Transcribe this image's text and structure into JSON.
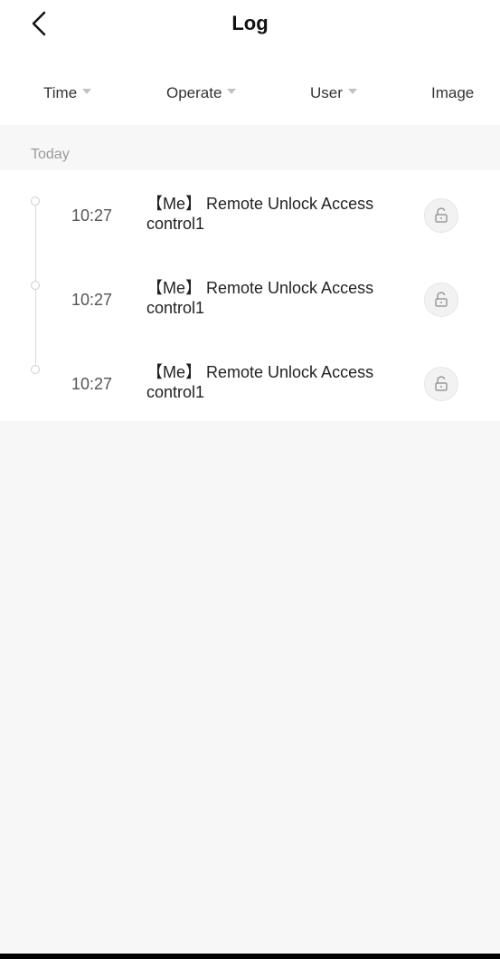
{
  "header": {
    "title": "Log",
    "back_icon": "chevron-left-icon"
  },
  "filters": [
    {
      "label": "Time",
      "has_dropdown": true
    },
    {
      "label": "Operate",
      "has_dropdown": true
    },
    {
      "label": "User",
      "has_dropdown": true
    },
    {
      "label": "Image",
      "has_dropdown": false
    }
  ],
  "section": {
    "label": "Today"
  },
  "entries": [
    {
      "time": "10:27",
      "description": "【Me】 Remote Unlock Access control1",
      "icon": "unlock-icon"
    },
    {
      "time": "10:27",
      "description": "【Me】 Remote Unlock Access control1",
      "icon": "unlock-icon"
    },
    {
      "time": "10:27",
      "description": "【Me】 Remote Unlock Access control1",
      "icon": "unlock-icon"
    }
  ],
  "colors": {
    "background": "#f7f7f7",
    "surface": "#ffffff",
    "muted_text": "#9a9a9a",
    "caret": "#c2c2c2"
  }
}
